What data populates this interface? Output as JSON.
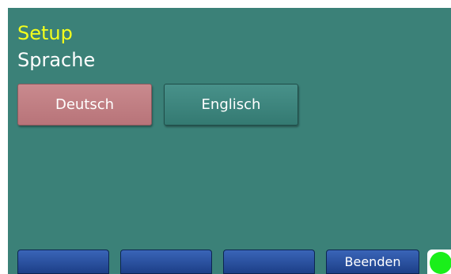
{
  "header": {
    "title": "Setup",
    "subtitle": "Sprache"
  },
  "language_options": [
    {
      "label": "Deutsch",
      "selected": true
    },
    {
      "label": "Englisch",
      "selected": false
    }
  ],
  "footer": {
    "buttons": [
      "",
      "",
      "",
      "Beenden"
    ]
  },
  "status": {
    "indicator": "online-dot-icon",
    "color": "#1aef1a"
  },
  "colors": {
    "background": "#3b8178",
    "title": "#f4ff1c",
    "selected_button": "#c98a8e",
    "footer_button": "#2a519f"
  }
}
